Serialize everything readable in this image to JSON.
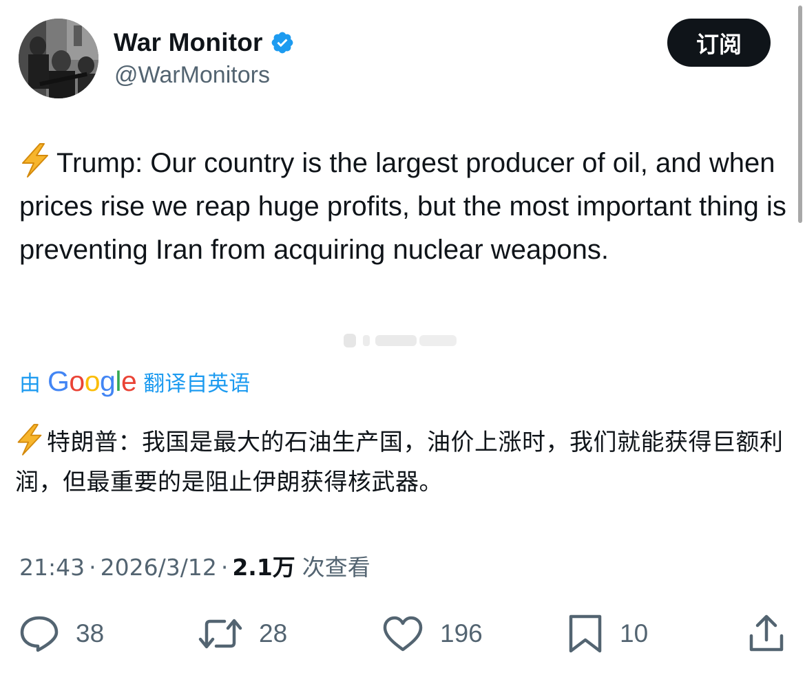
{
  "author": {
    "display_name": "War Monitor",
    "handle": "@WarMonitors",
    "verified": true,
    "verified_color": "#1d9bf0"
  },
  "subscribe_label": "订阅",
  "tweet": {
    "text": "Trump: Our country is the largest producer of oil, and when prices rise we reap huge profits, but the most important thing is preventing Iran from acquiring nuclear weapons.",
    "leading_emoji": "high-voltage-icon"
  },
  "translation": {
    "by_label": "由",
    "provider": "Google",
    "from_label": "翻译自英语",
    "text": "特朗普：我国是最大的石油生产国，油价上涨时，我们就能获得巨额利润，但最重要的是阻止伊朗获得核武器。"
  },
  "meta": {
    "time": "21:43",
    "separator": "·",
    "date": "2026/3/12",
    "views_count": "2.1万",
    "views_label": "次查看"
  },
  "actions": {
    "replies": "38",
    "reposts": "28",
    "likes": "196",
    "bookmarks": "10"
  },
  "colors": {
    "text_primary": "#0f1419",
    "text_secondary": "#536471",
    "accent": "#1d9bf0",
    "button_bg": "#0f1419"
  }
}
